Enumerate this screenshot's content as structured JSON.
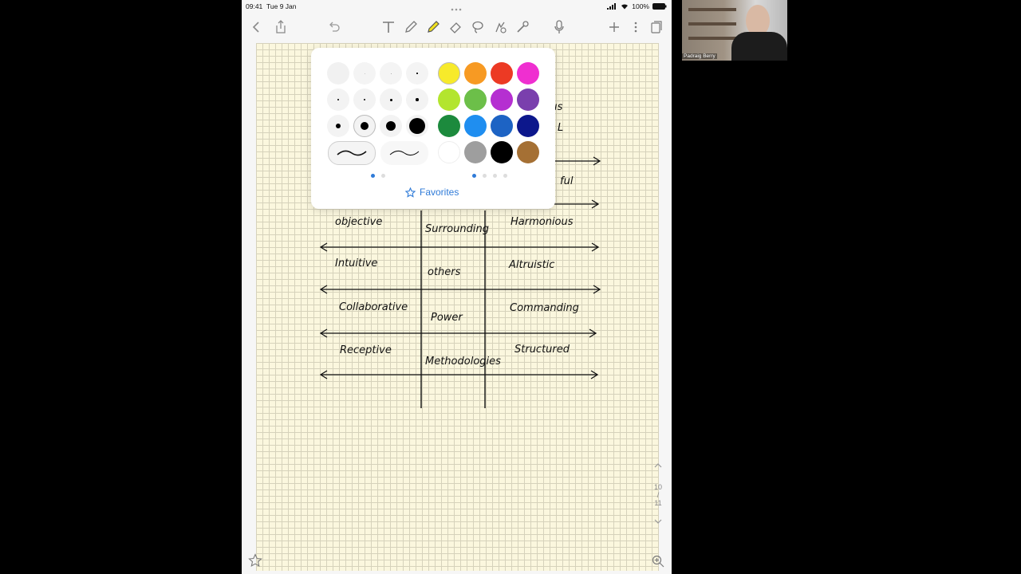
{
  "status_bar": {
    "time": "09:41",
    "date": "Tue 9 Jan",
    "battery": "100%"
  },
  "toolbar": {
    "left_icons": [
      "chevron-left-icon",
      "share-icon",
      "undo-icon"
    ],
    "tools": [
      "text-tool-icon",
      "pen-tool-icon",
      "highlighter-tool-icon",
      "eraser-tool-icon",
      "lasso-tool-icon",
      "shapes-tool-icon",
      "laser-pointer-icon"
    ],
    "right_icons": [
      "microphone-icon",
      "plus-icon",
      "more-icon",
      "pages-icon"
    ],
    "active_tool": "highlighter"
  },
  "popover": {
    "favorites_label": "Favorites",
    "colors": [
      "#f7ea2b",
      "#f79a23",
      "#ec3a24",
      "#ef2fd0",
      "#b3e52e",
      "#6cbf49",
      "#b52fd1",
      "#7a3fad",
      "#1c8a3d",
      "#1f8ef0",
      "#1d63c4",
      "#0c178c",
      "#ffffff",
      "#9e9e9e",
      "#000000",
      "#a57034"
    ]
  },
  "notes": {
    "partial_right_top": [
      "ıs",
      "L",
      "ful"
    ],
    "left_column": [
      "objective",
      "Intuitive",
      "Collaborative",
      "Receptive"
    ],
    "middle_column": [
      "Surrounding",
      "others",
      "Power",
      "Methodologies"
    ],
    "right_column": [
      "Harmonious",
      "Altruistic",
      "Commanding",
      "Structured"
    ]
  },
  "page_nav": {
    "current": "10",
    "separator": "/",
    "total": "11"
  },
  "webcam": {
    "name": "Padraig Berry"
  }
}
